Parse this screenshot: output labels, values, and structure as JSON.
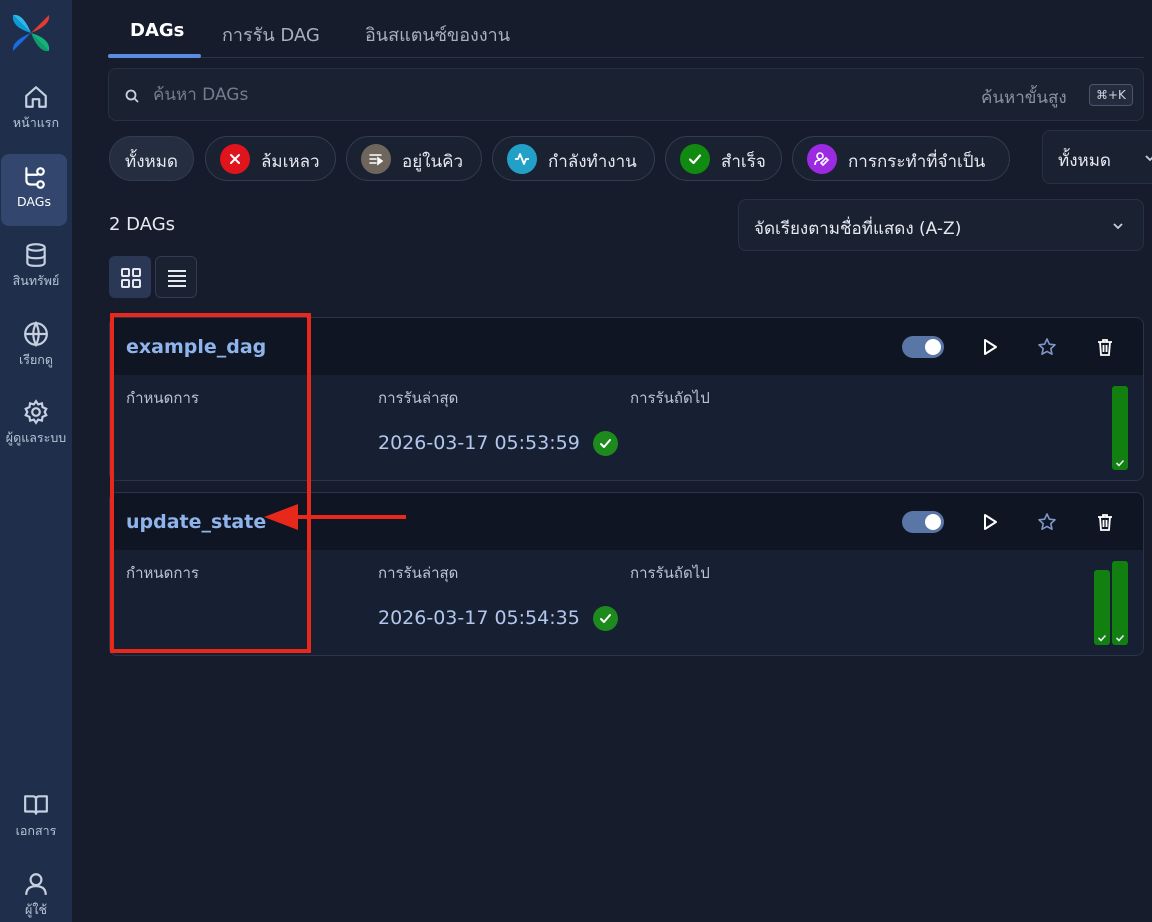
{
  "sidebar": {
    "items": [
      {
        "label": "หน้าแรก",
        "icon": "home-icon"
      },
      {
        "label": "DAGs",
        "icon": "dags-icon",
        "active": true
      },
      {
        "label": "สินทรัพย์",
        "icon": "database-icon"
      },
      {
        "label": "เรียกดู",
        "icon": "globe-icon"
      },
      {
        "label": "ผู้ดูแลระบบ",
        "icon": "gear-icon"
      },
      {
        "label": "เอกสาร",
        "icon": "book-icon"
      },
      {
        "label": "ผู้ใช้",
        "icon": "user-icon"
      }
    ]
  },
  "tabs": [
    {
      "label": "DAGs",
      "active": true
    },
    {
      "label": "การรัน DAG"
    },
    {
      "label": "อินสแตนซ์ของงาน"
    }
  ],
  "search": {
    "placeholder": "ค้นหา DAGs",
    "advanced_label": "ค้นหาขั้นสูง",
    "shortcut": "⌘+K"
  },
  "filters": [
    {
      "label": "ทั้งหมด",
      "selected": true
    },
    {
      "label": "ล้มเหลว",
      "color": "#e0141c",
      "icon": "x-icon"
    },
    {
      "label": "อยู่ในคิว",
      "color": "#6e665c",
      "icon": "queue-icon"
    },
    {
      "label": "กำลังทำงาน",
      "color": "#22a0c8",
      "icon": "activity-icon"
    },
    {
      "label": "สำเร็จ",
      "color": "#108a10",
      "icon": "check-icon"
    },
    {
      "label": "การกระทำที่จำเป็น",
      "color": "#9b2ae0",
      "icon": "user-action-icon"
    }
  ],
  "tag_filter": {
    "value": "ทั้งหมด"
  },
  "dag_count": "2 DAGs",
  "sort": {
    "value": "จัดเรียงตามชื่อที่แสดง (A-Z)"
  },
  "columns": {
    "schedule": "กำหนดการ",
    "latest_run": "การรันล่าสุด",
    "next_run": "การรันถัดไป"
  },
  "dags": [
    {
      "name": "example_dag",
      "paused": false,
      "latest_run": "2026-03-17 05:53:59",
      "state": "success",
      "recent_runs": [
        1.0
      ]
    },
    {
      "name": "update_state",
      "paused": false,
      "latest_run": "2026-03-17 05:54:35",
      "state": "success",
      "recent_runs": [
        0.86,
        1.0
      ]
    }
  ],
  "colors": {
    "background": "#161c2b",
    "sidebar": "#1f2e4b",
    "accent": "#5b8de0",
    "success": "#118011",
    "annotation": "#e8281a"
  }
}
